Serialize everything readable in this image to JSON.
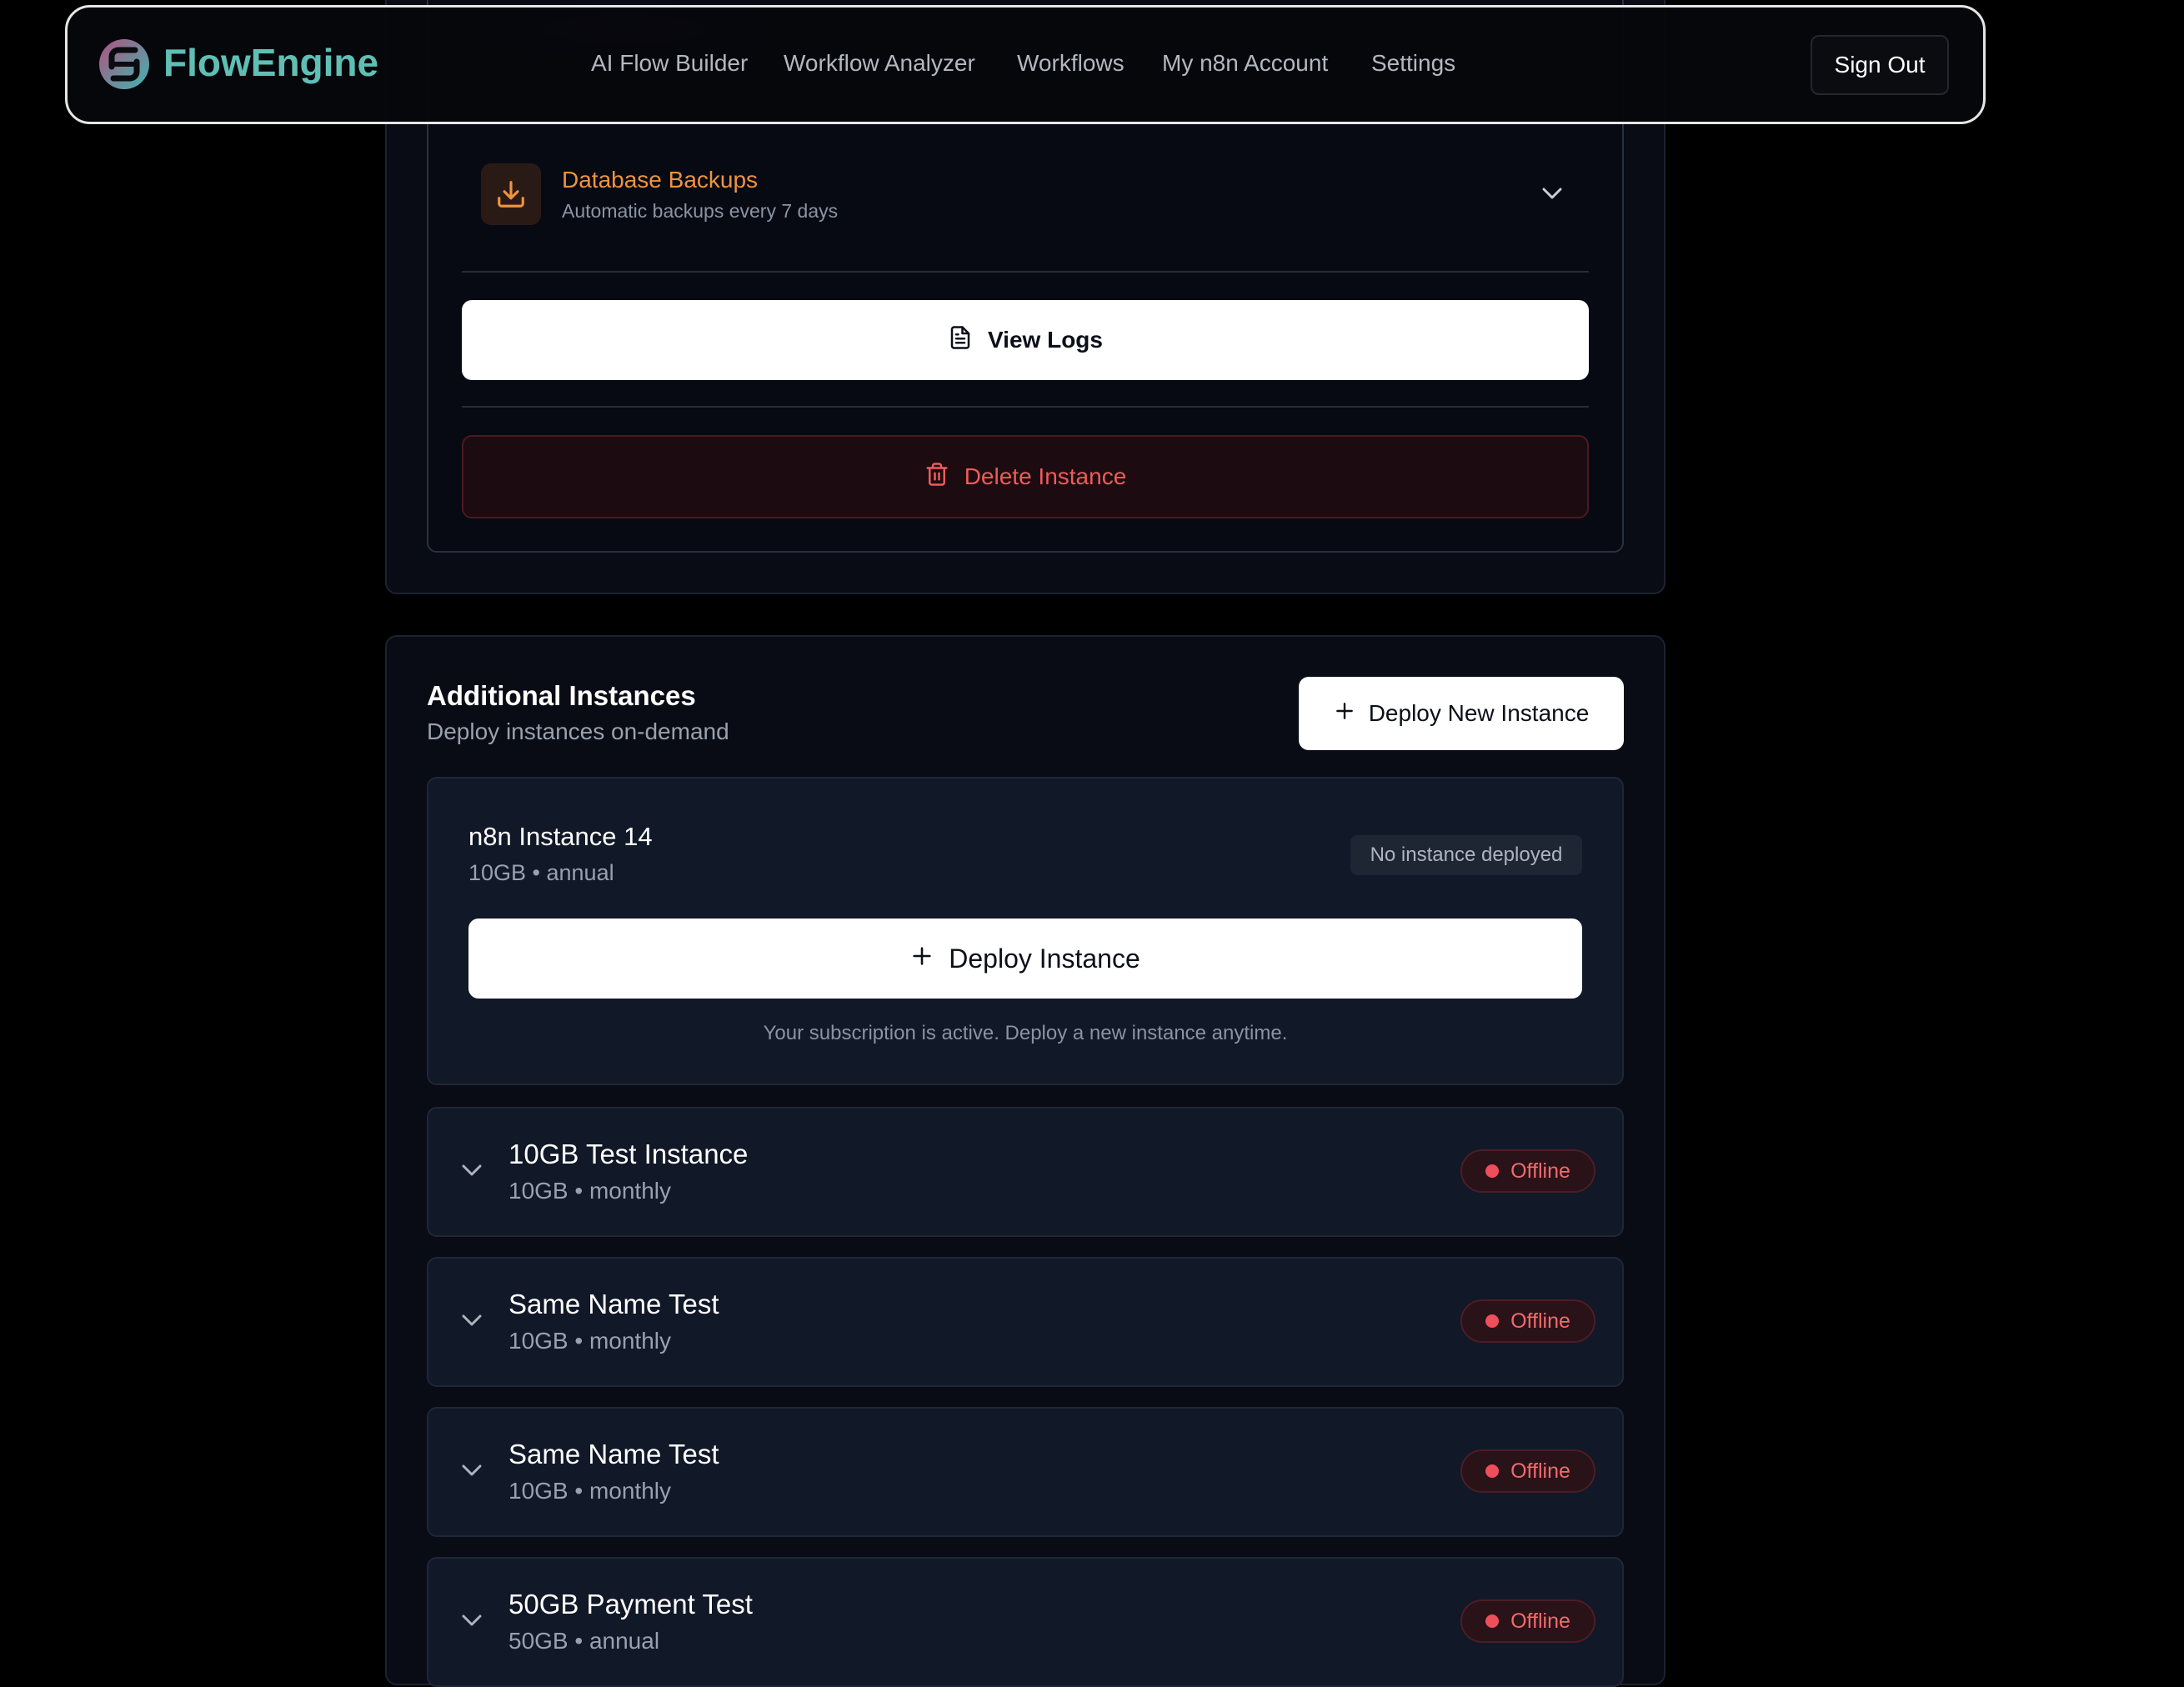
{
  "app": {
    "name": "FlowEngine"
  },
  "nav": {
    "items": [
      "AI Flow Builder",
      "Workflow Analyzer",
      "Workflows",
      "My n8n Account",
      "Settings"
    ],
    "sign_out": "Sign Out"
  },
  "top_card": {
    "backup_title": "Database Backups",
    "backup_subtitle": "Automatic backups every 7 days",
    "view_logs": "View Logs",
    "delete_instance": "Delete Instance"
  },
  "additional": {
    "title": "Additional Instances",
    "subtitle": "Deploy instances on-demand",
    "deploy_new": "Deploy New Instance",
    "pending": {
      "name": "n8n Instance 14",
      "details": "10GB • annual",
      "badge": "No instance deployed",
      "deploy_button": "Deploy Instance",
      "message": "Your subscription is active. Deploy a new instance anytime."
    },
    "instances": [
      {
        "name": "10GB Test Instance",
        "details": "10GB • monthly",
        "status": "Offline"
      },
      {
        "name": "Same Name Test",
        "details": "10GB • monthly",
        "status": "Offline"
      },
      {
        "name": "Same Name Test",
        "details": "10GB • monthly",
        "status": "Offline"
      },
      {
        "name": "50GB Payment Test",
        "details": "50GB • annual",
        "status": "Offline"
      }
    ]
  },
  "colors": {
    "brand": "#5fbfb5",
    "backup_accent": "#f0923f",
    "danger": "#ef5b5b",
    "offline": "#ef4f5a"
  },
  "icons": [
    "download-icon",
    "chevron-down-icon",
    "file-text-icon",
    "trash-icon",
    "plus-icon",
    "logo-icon"
  ]
}
